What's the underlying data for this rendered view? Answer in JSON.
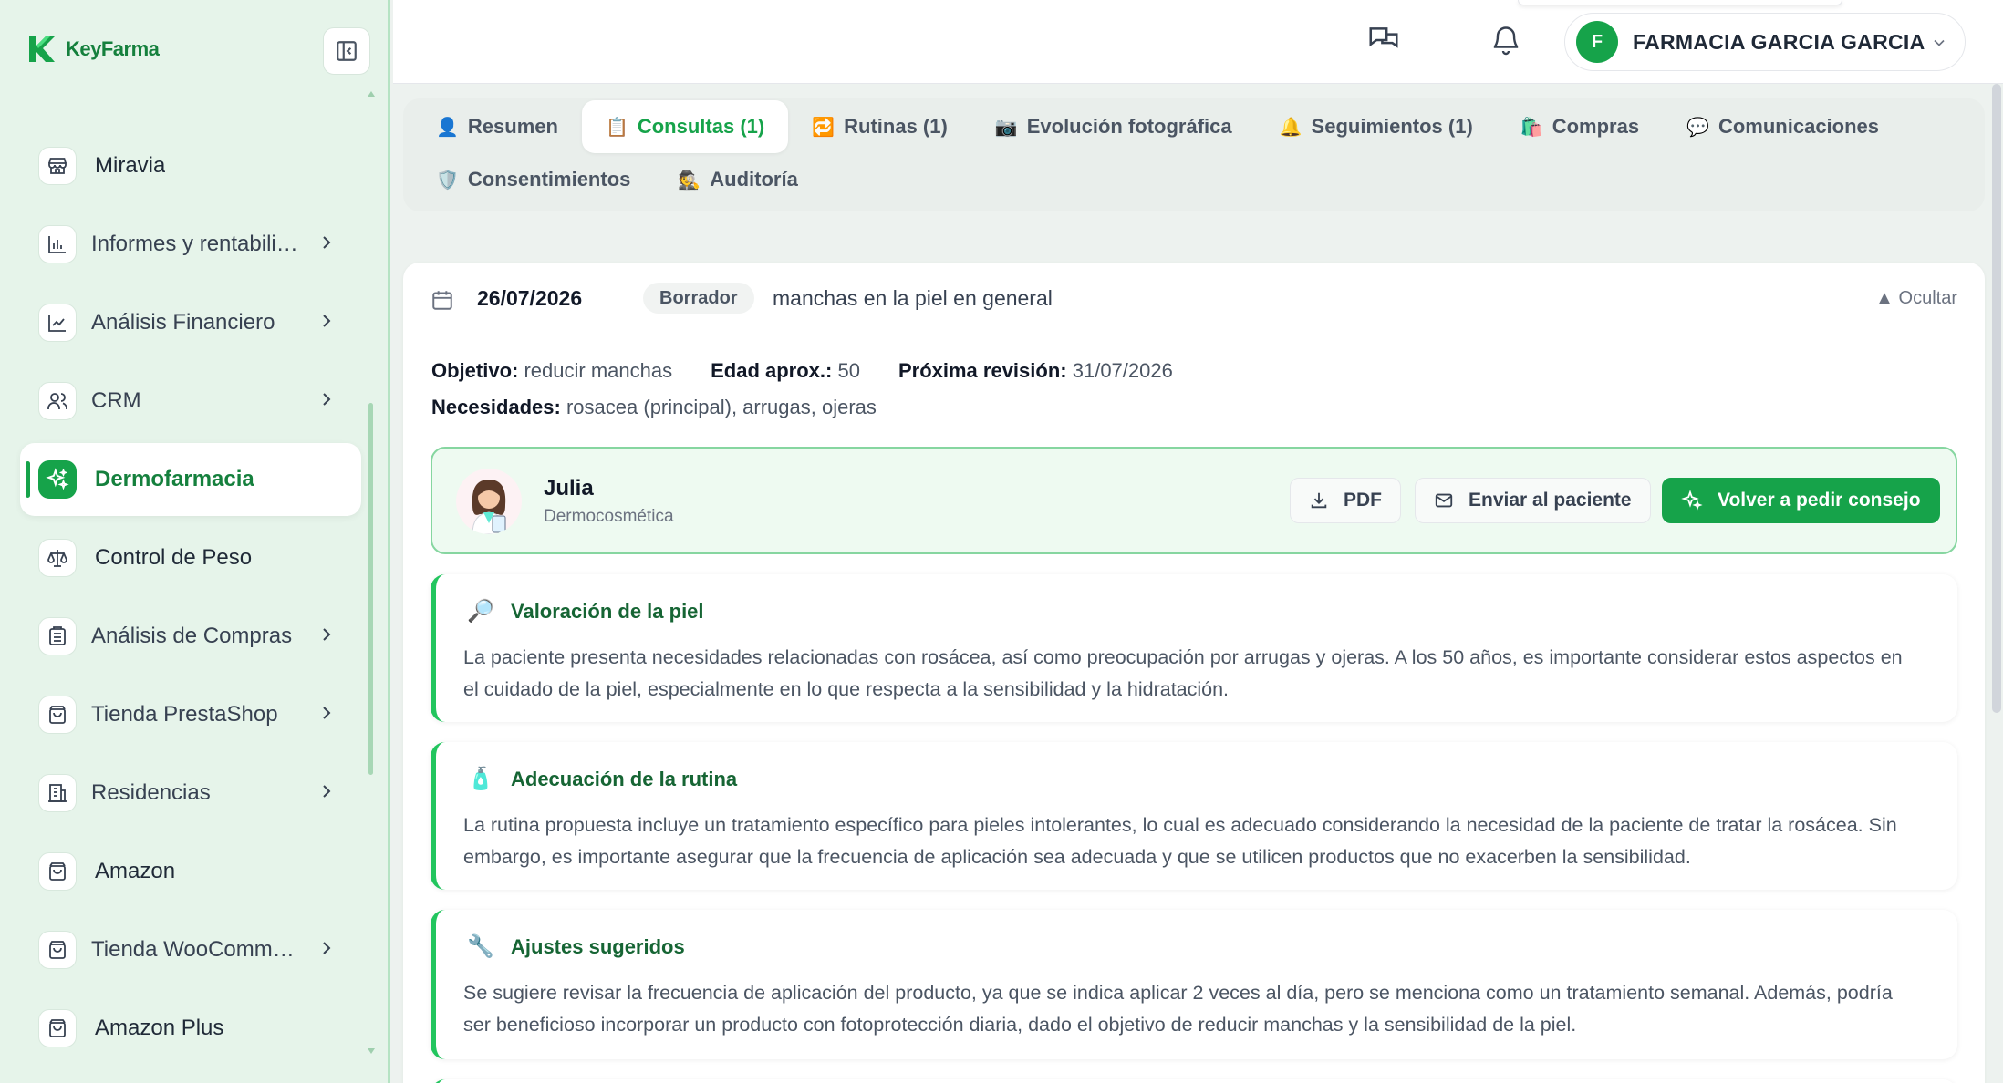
{
  "brand": {
    "name": "KeyFarma",
    "accent": "#16a34a"
  },
  "sidebar": {
    "items": [
      {
        "label": "Miravia",
        "icon": "store-icon",
        "expandable": false,
        "active": false
      },
      {
        "label": "Informes y rentabili…",
        "icon": "bar-chart-icon",
        "expandable": true,
        "active": false
      },
      {
        "label": "Análisis Financiero",
        "icon": "line-chart-icon",
        "expandable": true,
        "active": false
      },
      {
        "label": "CRM",
        "icon": "users-icon",
        "expandable": true,
        "active": false
      },
      {
        "label": "Dermofarmacia",
        "icon": "sparkles-icon",
        "expandable": false,
        "active": true
      },
      {
        "label": "Control de Peso",
        "icon": "scale-icon",
        "expandable": false,
        "active": false
      },
      {
        "label": "Análisis de Compras",
        "icon": "receipt-icon",
        "expandable": true,
        "active": false
      },
      {
        "label": "Tienda PrestaShop",
        "icon": "shopping-bag-icon",
        "expandable": true,
        "active": false
      },
      {
        "label": "Residencias",
        "icon": "building-icon",
        "expandable": true,
        "active": false
      },
      {
        "label": "Amazon",
        "icon": "shopping-bag-icon",
        "expandable": false,
        "active": false
      },
      {
        "label": "Tienda WooComme…",
        "icon": "shopping-bag-icon",
        "expandable": true,
        "active": false
      },
      {
        "label": "Amazon Plus",
        "icon": "shopping-bag-icon",
        "expandable": false,
        "active": false
      }
    ]
  },
  "header": {
    "user_initial": "F",
    "user_name": "FARMACIA GARCIA GARCIA"
  },
  "tabs": [
    {
      "emoji": "👤",
      "label": "Resumen",
      "active": false
    },
    {
      "emoji": "📋",
      "label": "Consultas (1)",
      "active": true
    },
    {
      "emoji": "🔁",
      "label": "Rutinas (1)",
      "active": false
    },
    {
      "emoji": "📷",
      "label": "Evolución fotográfica",
      "active": false
    },
    {
      "emoji": "🔔",
      "label": "Seguimientos (1)",
      "active": false
    },
    {
      "emoji": "🛍️",
      "label": "Compras",
      "active": false
    },
    {
      "emoji": "💬",
      "label": "Comunicaciones",
      "active": false
    },
    {
      "emoji": "🛡️",
      "label": "Consentimientos",
      "active": false
    },
    {
      "emoji": "🕵️",
      "label": "Auditoría",
      "active": false
    }
  ],
  "consultation": {
    "date": "26/07/2026",
    "status": "Borrador",
    "description": "manchas en la piel en general",
    "hide_label": "▲ Ocultar",
    "objective_label": "Objetivo:",
    "objective": "reducir manchas",
    "age_label": "Edad aprox.:",
    "age": "50",
    "next_review_label": "Próxima revisión:",
    "next_review": "31/07/2026",
    "needs_label": "Necesidades:",
    "needs": "rosacea (principal), arrugas, ojeras"
  },
  "advisor": {
    "name": "Julia",
    "role": "Dermocosmética",
    "pdf_label": "PDF",
    "send_label": "Enviar al paciente",
    "retry_label": "Volver a pedir consejo"
  },
  "sections": [
    {
      "emoji": "🔎",
      "title": "Valoración de la piel",
      "body": "La paciente presenta necesidades relacionadas con rosácea, así como preocupación por arrugas y ojeras. A los 50 años, es importante considerar estos aspectos en el cuidado de la piel, especialmente en lo que respecta a la sensibilidad y la hidratación."
    },
    {
      "emoji": "🧴",
      "title": "Adecuación de la rutina",
      "body": "La rutina propuesta incluye un tratamiento específico para pieles intolerantes, lo cual es adecuado considerando la necesidad de la paciente de tratar la rosácea. Sin embargo, es importante asegurar que la frecuencia de aplicación sea adecuada y que se utilicen productos que no exacerben la sensibilidad."
    },
    {
      "emoji": "🔧",
      "title": "Ajustes sugeridos",
      "body": "Se sugiere revisar la frecuencia de aplicación del producto, ya que se indica aplicar 2 veces al día, pero se menciona como un tratamiento semanal. Además, podría ser beneficioso incorporar un producto con fotoprotección diaria, dado el objetivo de reducir manchas y la sensibilidad de la piel."
    }
  ]
}
